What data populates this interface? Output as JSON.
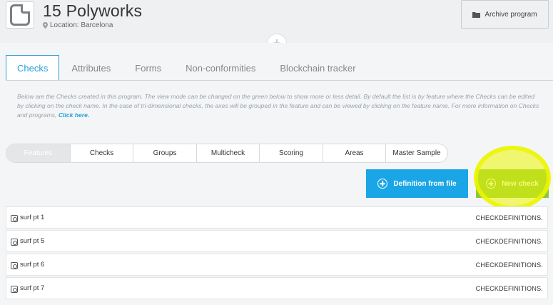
{
  "program": {
    "title": "15 Polyworks",
    "location": "Location: Barcelona"
  },
  "header": {
    "archive_label": "Archive program",
    "add_symbol": "+"
  },
  "tabs": [
    {
      "label": "Checks",
      "active": true
    },
    {
      "label": "Attributes",
      "active": false
    },
    {
      "label": "Forms",
      "active": false
    },
    {
      "label": "Non-conformities",
      "active": false
    },
    {
      "label": "Blockchain tracker",
      "active": false
    }
  ],
  "description": {
    "text": "Below are the Checks created in this program. The view mode can be changed on the green below to show more or less detail. By default the list is by feature where the Checks can be edited by clicking on the check name. In the case of tri-dimensional checks, the axes will be grouped in the feature and can be viewed by clicking on the feature name. For more information on Checks and programs,",
    "link": "Click here."
  },
  "view_modes": [
    {
      "label": "Features",
      "active": true
    },
    {
      "label": "Checks",
      "active": false
    },
    {
      "label": "Groups",
      "active": false
    },
    {
      "label": "Multicheck",
      "active": false
    },
    {
      "label": "Scoring",
      "active": false
    },
    {
      "label": "Areas",
      "active": false
    },
    {
      "label": "Master Sample",
      "active": false
    }
  ],
  "actions": {
    "definition_label": "Definition from file",
    "new_check_label": "New check"
  },
  "features": [
    {
      "name": "surf pt 1",
      "status": "CHECKDEFINITIONS."
    },
    {
      "name": "surf pt 5",
      "status": "CHECKDEFINITIONS."
    },
    {
      "name": "surf pt 6",
      "status": "CHECKDEFINITIONS."
    },
    {
      "name": "surf pt 7",
      "status": "CHECKDEFINITIONS."
    }
  ],
  "colors": {
    "accent": "#2aa0d8",
    "primary_button": "#1aa6e6",
    "new_button": "#8cc63f",
    "highlight": "#ecf600"
  }
}
